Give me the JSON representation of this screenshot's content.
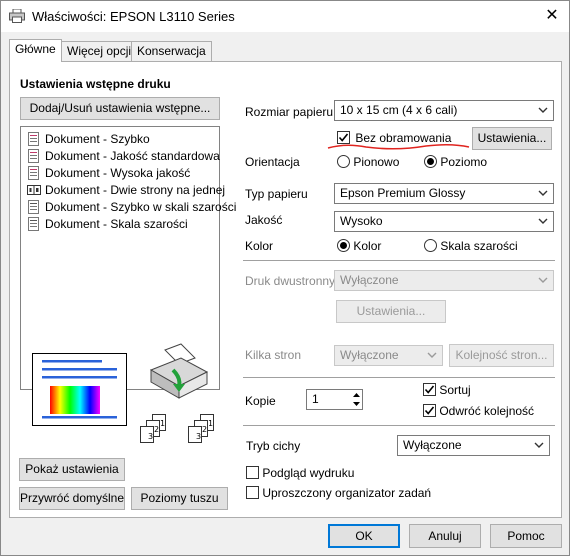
{
  "window": {
    "title": "Właściwości: EPSON L3110 Series",
    "close_glyph": "✕"
  },
  "tabs": [
    {
      "label": "Główne",
      "active": true
    },
    {
      "label": "Więcej opcji",
      "active": false
    },
    {
      "label": "Konserwacja",
      "active": false
    }
  ],
  "presets": {
    "heading": "Ustawienia wstępne druku",
    "add_remove_button": "Dodaj/Usuń ustawienia wstępne...",
    "items": [
      "Dokument - Szybko",
      "Dokument - Jakość standardowa",
      "Dokument - Wysoka jakość",
      "Dokument - Dwie strony na jednej",
      "Dokument - Szybko w skali szarości",
      "Dokument - Skala szarości"
    ]
  },
  "preview": {
    "copy_badges": [
      "3",
      "2",
      "1"
    ]
  },
  "left_buttons": {
    "show_settings": "Pokaż ustawienia",
    "restore_defaults": "Przywróć domyślne",
    "ink_levels": "Poziomy tuszu"
  },
  "settings": {
    "paper_size_label": "Rozmiar papieru",
    "paper_size_value": "10 x 15 cm (4 x 6 cali)",
    "borderless_label": "Bez obramowania",
    "borderless_checked": true,
    "settings_button": "Ustawienia...",
    "orientation_label": "Orientacja",
    "orientation_portrait": "Pionowo",
    "orientation_landscape": "Poziomo",
    "orientation_selected": "landscape",
    "paper_type_label": "Typ papieru",
    "paper_type_value": "Epson Premium Glossy",
    "quality_label": "Jakość",
    "quality_value": "Wysoko",
    "color_label": "Kolor",
    "color_color": "Kolor",
    "color_grayscale": "Skala szarości",
    "color_selected": "color",
    "duplex_label": "Druk dwustronny",
    "duplex_value": "Wyłączone",
    "duplex_settings_button": "Ustawienia...",
    "multipage_label": "Kilka stron",
    "multipage_value": "Wyłączone",
    "page_order_button": "Kolejność stron...",
    "copies_label": "Kopie",
    "copies_value": "1",
    "collate_label": "Sortuj",
    "collate_checked": true,
    "reverse_label": "Odwróć kolejność",
    "reverse_checked": true,
    "quiet_mode_label": "Tryb cichy",
    "quiet_mode_value": "Wyłączone",
    "print_preview_label": "Podgląd wydruku",
    "print_preview_checked": false,
    "job_arranger_label": "Uproszczony organizator zadań",
    "job_arranger_checked": false
  },
  "footer": {
    "ok": "OK",
    "cancel": "Anuluj",
    "help": "Pomoc"
  },
  "colors": {
    "accent": "#0078d7",
    "annotation_red": "#e0241f"
  }
}
